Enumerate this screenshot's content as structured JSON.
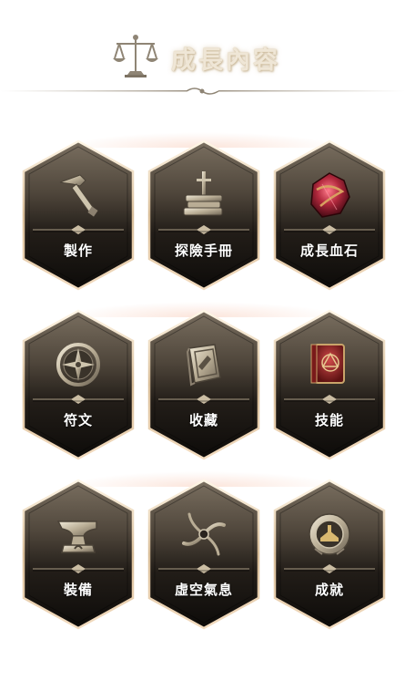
{
  "header": {
    "title": "成長內容",
    "icon": "scale-icon"
  },
  "tiles": [
    {
      "label": "製作",
      "icon": "hammer-icon"
    },
    {
      "label": "探險手冊",
      "icon": "books-sword-icon"
    },
    {
      "label": "成長血石",
      "icon": "bloodstone-icon"
    },
    {
      "label": "符文",
      "icon": "compass-rune-icon"
    },
    {
      "label": "收藏",
      "icon": "collection-book-icon"
    },
    {
      "label": "技能",
      "icon": "skill-tome-icon"
    },
    {
      "label": "裝備",
      "icon": "anvil-icon"
    },
    {
      "label": "虛空氣息",
      "icon": "void-swirl-icon"
    },
    {
      "label": "成就",
      "icon": "achievement-medal-icon"
    }
  ],
  "colors": {
    "tile_top": "#6f6556",
    "tile_bottom": "#0f0c0a",
    "tile_border": "#e8d2b2",
    "title": "#efe6d6"
  }
}
